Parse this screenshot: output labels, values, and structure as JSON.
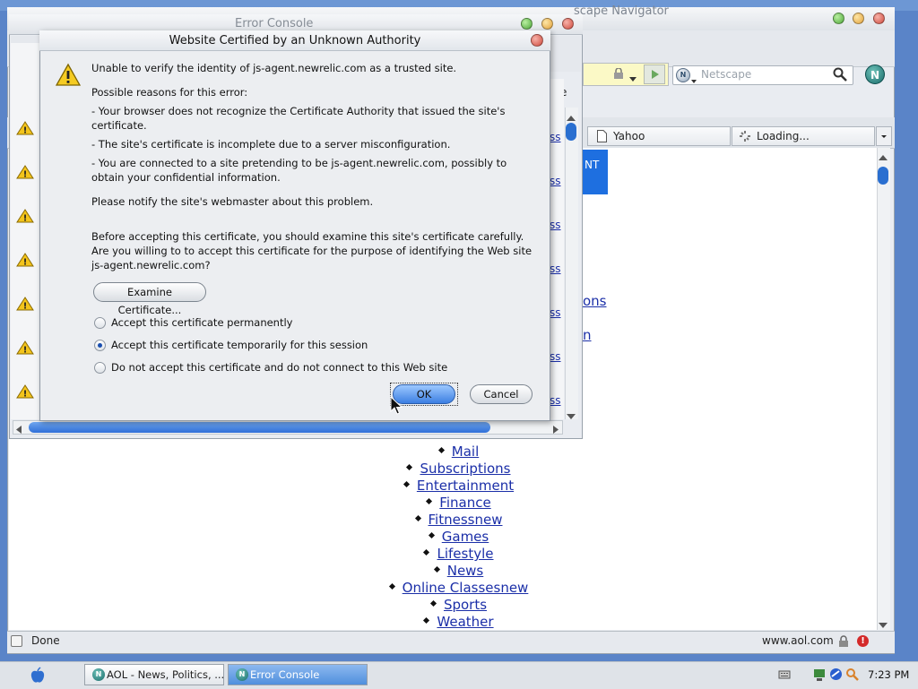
{
  "navigator": {
    "title": "scape Navigator",
    "search_placeholder": "Netscape",
    "logo_letter": "N",
    "tabs": [
      {
        "label": "Yahoo"
      },
      {
        "label": "Loading..."
      }
    ],
    "partial_text": "NT",
    "partial_links": [
      "ons",
      "n"
    ],
    "menu_links": [
      "Mail",
      "Subscriptions",
      "Entertainment",
      "Finance",
      "Fitnessnew",
      "Games",
      "Lifestyle",
      "News",
      "Online Classesnew",
      "Sports",
      "Weather"
    ],
    "status_text": "Done",
    "status_url": "www.aol.com"
  },
  "error_console": {
    "title": "Error Console",
    "side_label": "ate",
    "link_fragments": [
      "ss",
      "ss",
      "ss",
      "ss",
      "ss",
      "ss",
      "ss"
    ]
  },
  "dialog": {
    "title": "Website Certified by an Unknown Authority",
    "intro": "Unable to verify the identity of js-agent.newrelic.com as a trusted site.",
    "reasons_header": "Possible reasons for this error:",
    "reasons": [
      "- Your browser does not recognize the Certificate Authority that issued the site's certificate.",
      "- The site's certificate is incomplete due to a server misconfiguration.",
      "- You are connected to a site pretending to be js-agent.newrelic.com, possibly to obtain your confidential information."
    ],
    "notify": "Please notify the site's webmaster about this problem.",
    "before": "Before accepting this certificate, you should examine this site's certificate carefully. Are you willing to to accept this certificate for the purpose of identifying the Web site js-agent.newrelic.com?",
    "examine_label": "Examine Certificate...",
    "options": [
      {
        "label": "Accept this certificate permanently",
        "selected": false
      },
      {
        "label": "Accept this certificate temporarily for this session",
        "selected": true
      },
      {
        "label": "Do not accept this certificate and do not connect to this Web site",
        "selected": false
      }
    ],
    "ok_label": "OK",
    "cancel_label": "Cancel"
  },
  "taskbar": {
    "items": [
      {
        "label": "AOL - News, Politics, ...",
        "active": false
      },
      {
        "label": "Error Console",
        "active": true
      }
    ],
    "clock": "7:23 PM"
  },
  "colors": {
    "accent": "#3c7fe2",
    "link": "#1b2fa8",
    "error": "#d42a2a"
  }
}
